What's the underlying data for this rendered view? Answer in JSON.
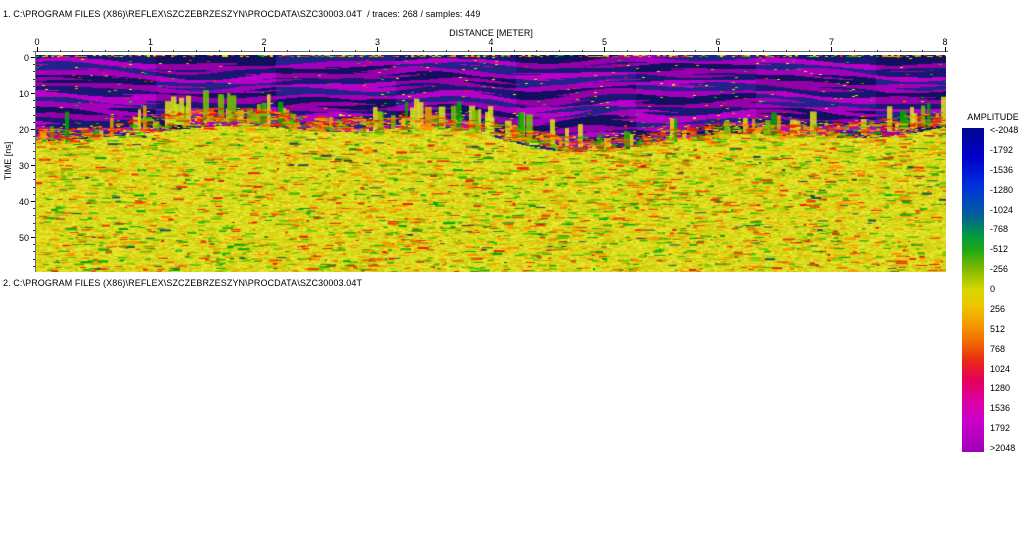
{
  "sections": {
    "primary_title": "1. C:\\PROGRAM FILES (X86)\\REFLEX\\SZCZEBRZESZYN\\PROCDATA\\SZC30003.04T  / traces: 268 / samples: 449",
    "secondary_title": "2. C:\\PROGRAM FILES (X86)\\REFLEX\\SZCZEBRZESZYN\\PROCDATA\\SZC30003.04T"
  },
  "plot": {
    "x_axis": {
      "label": "DISTANCE [METER]",
      "ticks": [
        "0",
        "1",
        "2",
        "3",
        "4",
        "5",
        "6",
        "7",
        "8"
      ],
      "minor_per_major": 5
    },
    "y_axis": {
      "label": "TIME [ns]",
      "ticks": [
        "0",
        "10",
        "20",
        "30",
        "40",
        "50"
      ],
      "minor_step_ns": 2,
      "max_minor_ns": 58
    }
  },
  "colorbar": {
    "title": "AMPLITUDE",
    "labels": [
      "<-2048",
      "-1792",
      "-1536",
      "-1280",
      "-1024",
      "-768",
      "-512",
      "-256",
      "0",
      "256",
      "512",
      "768",
      "1024",
      "1280",
      "1536",
      "1792",
      ">2048"
    ],
    "gradient": [
      "#000890 0%",
      "#0000cc 9%",
      "#0030dd 18%",
      "#00609a 27%",
      "#009944 33%",
      "#22aa11 38%",
      "#88bb00 44%",
      "#d8d800 50%",
      "#eec400 55%",
      "#f59700 61%",
      "#f06000 67%",
      "#e82818 72%",
      "#e5005a 78%",
      "#dc00a0 84%",
      "#cc00cc 90%",
      "#a000b8 100%"
    ]
  },
  "radargram": {
    "seed": 20034,
    "band_height": 5.5,
    "transition_depth": 80,
    "navy_colors": [
      "#181874",
      "#10105e",
      "#222288"
    ],
    "magenta_colors": [
      "#a400bc",
      "#b800c8",
      "#9600a8"
    ],
    "base_yellows": [
      "#d6d614",
      "#e0e020",
      "#cccc10",
      "#e8e830"
    ],
    "speckle_colors": [
      "#e8e800",
      "#ff9600",
      "#e63200",
      "#00c800"
    ],
    "streak_greens": [
      "#2cb400",
      "#00a800",
      "#70c800"
    ],
    "streak_oranges": [
      "#f0a000",
      "#ff8c00"
    ],
    "streak_reds": [
      "#e63c00",
      "#ee1e00"
    ],
    "streak_darks": [
      "#1e5050",
      "#3c5000"
    ]
  }
}
